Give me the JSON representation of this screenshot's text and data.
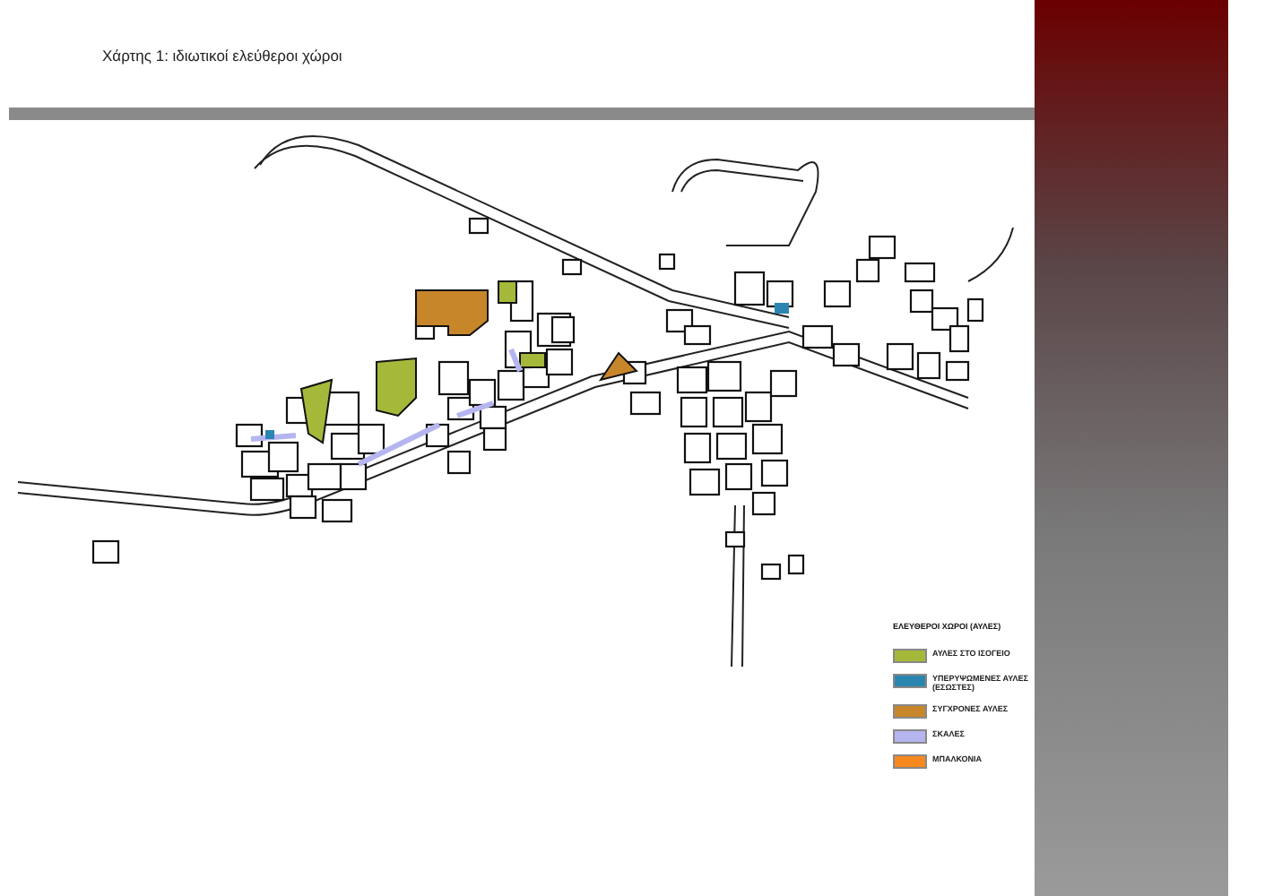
{
  "title": "Χάρτης 1:  ιδιωτικοί ελεύθεροι χώροι",
  "legend": {
    "heading": "ΕΛΕΥΘΕΡΟΙ ΧΩΡΟΙ (ΑΥΛΕΣ)",
    "items": [
      {
        "label": "ΑΥΛΕΣ ΣΤΟ ΙΣΟΓΕΙΟ",
        "color": "#a5b83a"
      },
      {
        "label": "ΥΠΕΡΥΨΩΜΕΝΕΣ ΑΥΛΕΣ (ΕΣΩΣΤΕΣ)",
        "color": "#2a86b0"
      },
      {
        "label": "ΣΥΓΧΡΟΝΕΣ ΑΥΛΕΣ",
        "color": "#c8862a"
      },
      {
        "label": "ΣΚΑΛΕΣ",
        "color": "#b5b5f0"
      },
      {
        "label": "ΜΠΑΛΚΟΝΙΑ",
        "color": "#f7881e"
      }
    ]
  }
}
